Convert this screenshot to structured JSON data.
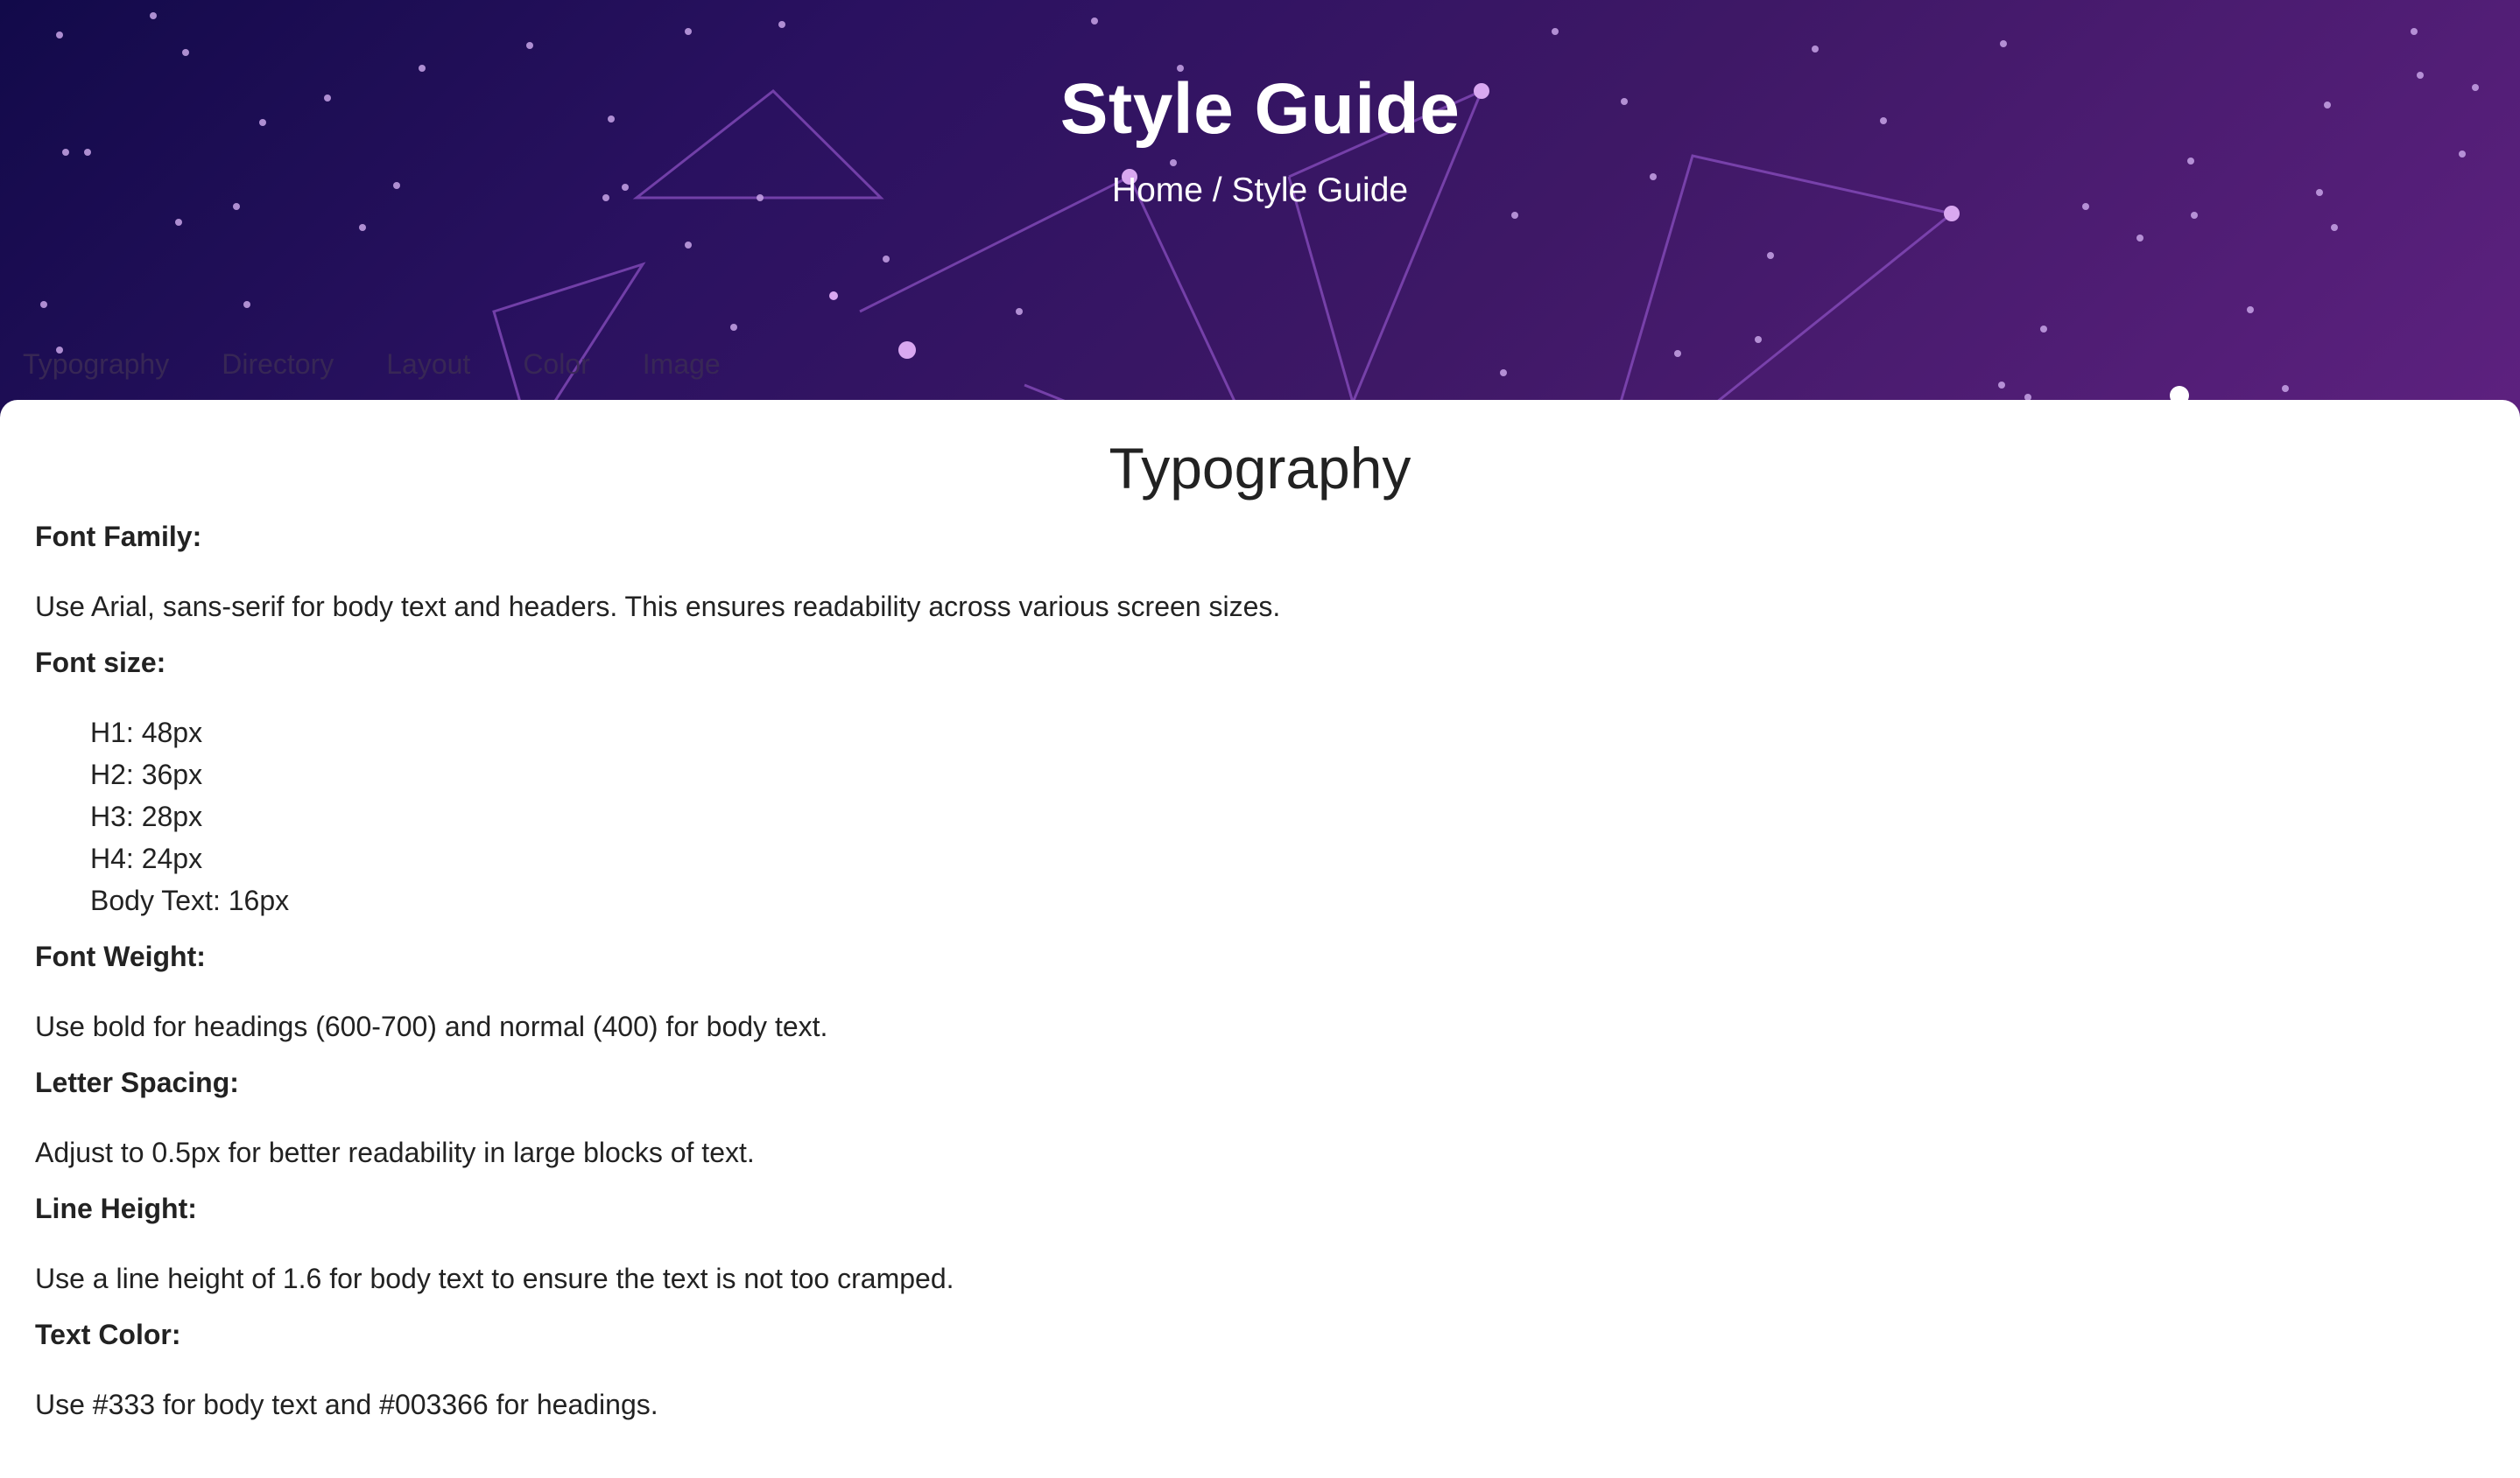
{
  "header": {
    "title": "Style Guide",
    "breadcrumb_home": "Home",
    "breadcrumb_separator": " / ",
    "breadcrumb_current": "Style Guide"
  },
  "nav": {
    "items": [
      "Typography",
      "Directory",
      "Layout",
      "Color",
      "Image"
    ]
  },
  "section": {
    "title": "Typography",
    "font_family_label": "Font Family:",
    "font_family_text": "Use Arial, sans-serif for body text and headers. This ensures readability across various screen sizes.",
    "font_size_label": "Font size:",
    "font_sizes": [
      "H1: 48px",
      "H2: 36px",
      "H3: 28px",
      "H4: 24px",
      "Body Text: 16px"
    ],
    "font_weight_label": "Font Weight:",
    "font_weight_text": "Use bold for headings (600-700) and normal (400) for body text.",
    "letter_spacing_label": "Letter Spacing:",
    "letter_spacing_text": "Adjust to 0.5px for better readability in large blocks of text.",
    "line_height_label": "Line Height:",
    "line_height_text": "Use a line height of 1.6 for body text to ensure the text is not too cramped.",
    "text_color_label": "Text Color:",
    "text_color_text": "Use #333 for body text and #003366 for headings."
  },
  "colors": {
    "hero_start": "#120a4a",
    "hero_end": "#5d217f",
    "text": "#222222",
    "card": "#ffffff"
  }
}
